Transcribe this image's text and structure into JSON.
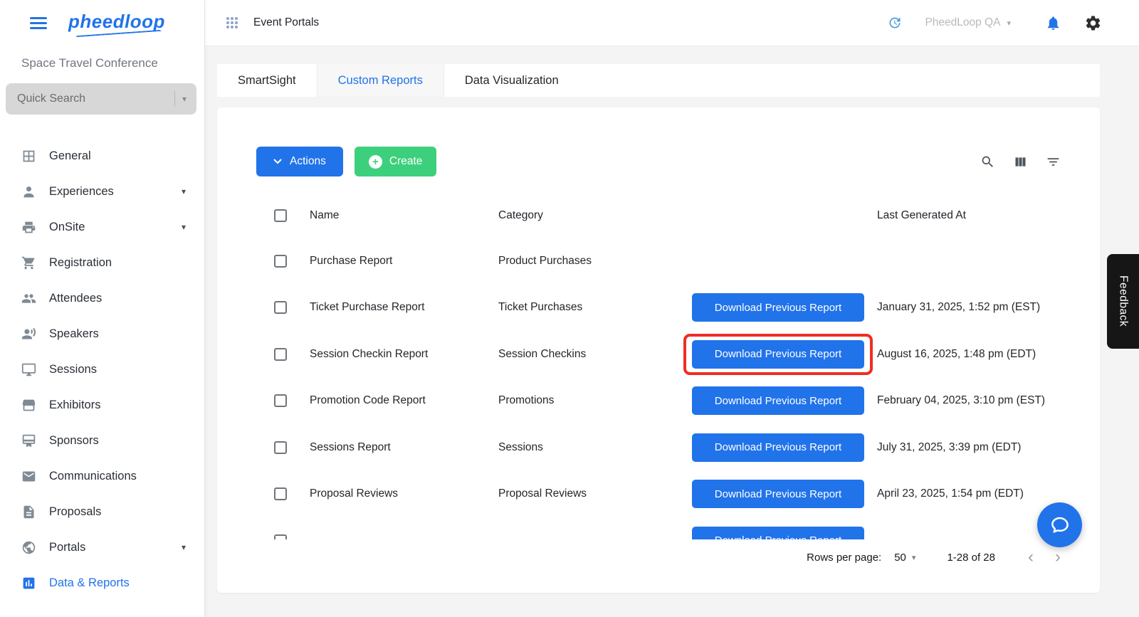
{
  "colors": {
    "accent": "#2173ea",
    "green": "#3dd07c",
    "highlight_red": "#ee2e24",
    "feedback_bg": "#161616"
  },
  "topbar": {
    "logo_text": "pheedloop",
    "page_title": "Event Portals",
    "account_label": "PheedLoop QA"
  },
  "sidebar": {
    "event_name": "Space Travel Conference",
    "search_placeholder": "Quick Search",
    "items": [
      {
        "label": "General",
        "icon": "grid",
        "chevron": false,
        "active": false
      },
      {
        "label": "Experiences",
        "icon": "person",
        "chevron": true,
        "active": false
      },
      {
        "label": "OnSite",
        "icon": "printer",
        "chevron": true,
        "active": false
      },
      {
        "label": "Registration",
        "icon": "cart",
        "chevron": false,
        "active": false
      },
      {
        "label": "Attendees",
        "icon": "people",
        "chevron": false,
        "active": false
      },
      {
        "label": "Speakers",
        "icon": "speaker-person",
        "chevron": false,
        "active": false
      },
      {
        "label": "Sessions",
        "icon": "monitor",
        "chevron": false,
        "active": false
      },
      {
        "label": "Exhibitors",
        "icon": "storefront",
        "chevron": false,
        "active": false
      },
      {
        "label": "Sponsors",
        "icon": "badge",
        "chevron": false,
        "active": false
      },
      {
        "label": "Communications",
        "icon": "mail",
        "chevron": false,
        "active": false
      },
      {
        "label": "Proposals",
        "icon": "document",
        "chevron": false,
        "active": false
      },
      {
        "label": "Portals",
        "icon": "globe",
        "chevron": true,
        "active": false
      },
      {
        "label": "Data & Reports",
        "icon": "chart",
        "chevron": false,
        "active": true
      }
    ]
  },
  "tabs": [
    {
      "label": "SmartSight",
      "selected": false
    },
    {
      "label": "Custom Reports",
      "selected": true
    },
    {
      "label": "Data Visualization",
      "selected": false
    }
  ],
  "toolbar": {
    "actions_label": "Actions",
    "create_label": "Create",
    "right_icons": [
      "search",
      "columns",
      "filter"
    ]
  },
  "table": {
    "headers": {
      "name": "Name",
      "category": "Category",
      "last_generated": "Last Generated At"
    },
    "download_label": "Download Previous Report",
    "rows": [
      {
        "name": "Purchase Report",
        "category": "Product Purchases",
        "has_button": false,
        "date": "",
        "highlighted": false
      },
      {
        "name": "Ticket Purchase Report",
        "category": "Ticket Purchases",
        "has_button": true,
        "date": "January 31, 2025, 1:52 pm (EST)",
        "highlighted": false
      },
      {
        "name": "Session Checkin Report",
        "category": "Session Checkins",
        "has_button": true,
        "date": "August 16, 2025, 1:48 pm (EDT)",
        "highlighted": true
      },
      {
        "name": "Promotion Code Report",
        "category": "Promotions",
        "has_button": true,
        "date": "February 04, 2025, 3:10 pm (EST)",
        "highlighted": false
      },
      {
        "name": "Sessions Report",
        "category": "Sessions",
        "has_button": true,
        "date": "July 31, 2025, 3:39 pm (EDT)",
        "highlighted": false
      },
      {
        "name": "Proposal Reviews",
        "category": "Proposal Reviews",
        "has_button": true,
        "date": "April 23, 2025, 1:54 pm (EDT)",
        "highlighted": false
      },
      {
        "name": "",
        "category": "",
        "has_button": true,
        "date": "",
        "highlighted": false
      }
    ]
  },
  "pagination": {
    "rows_per_page_label": "Rows per page:",
    "rows_per_page_value": "50",
    "range_label": "1-28 of 28"
  },
  "feedback_label": "Feedback"
}
